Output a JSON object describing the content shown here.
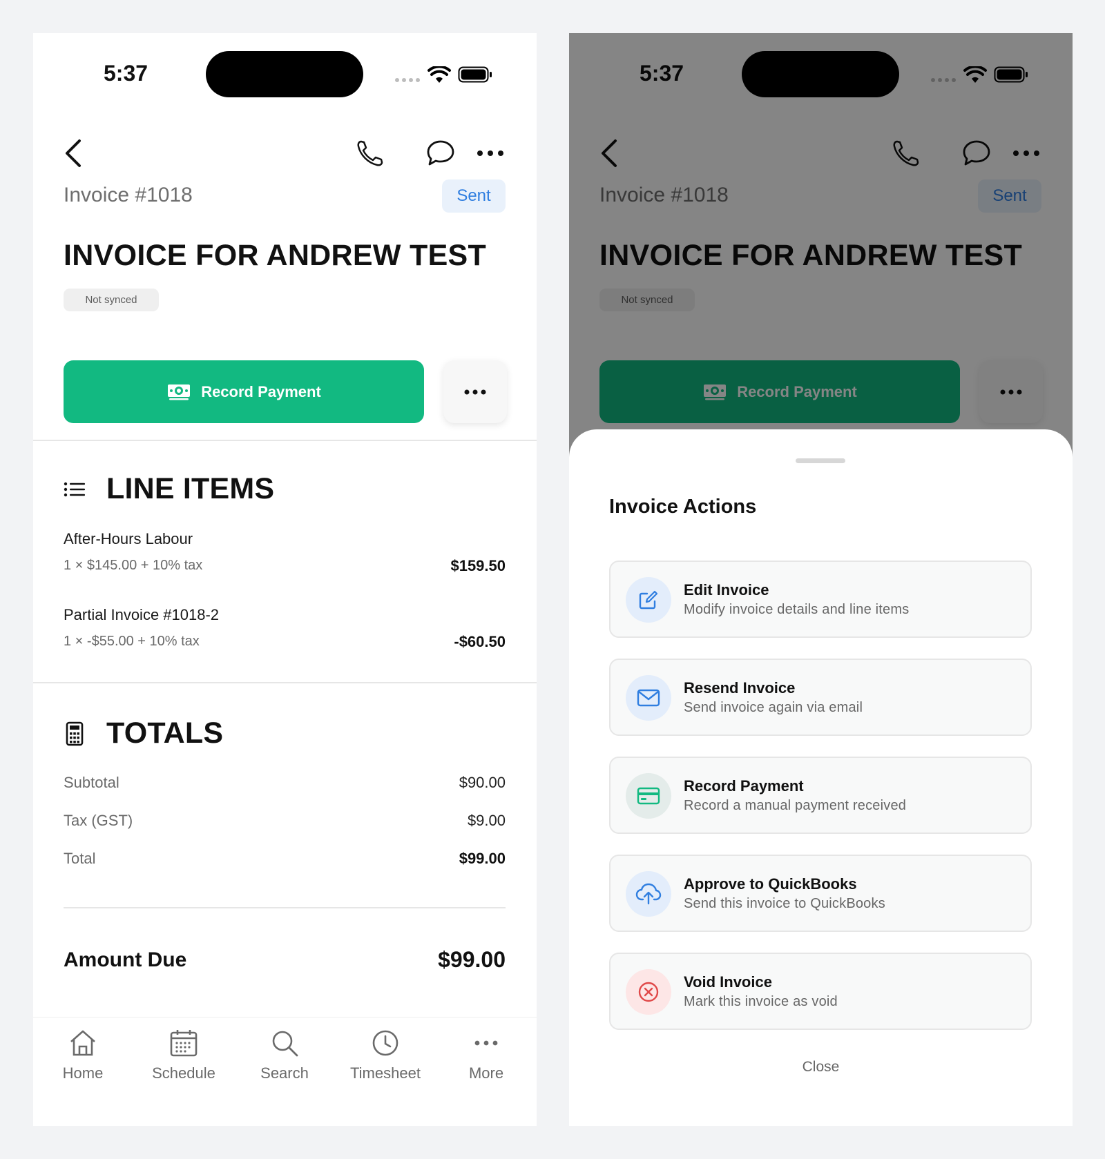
{
  "colors": {
    "green": "#12b981",
    "blue": "#2f7ee0",
    "red": "#e04848",
    "icon_blue_bg": "#e3edfb",
    "icon_green_bg": "#e4ecea",
    "icon_red_bg": "#fde6e6"
  },
  "status": {
    "time": "5:37"
  },
  "header": {
    "invoice_number": "Invoice #1018",
    "status_badge": "Sent",
    "title": "INVOICE FOR ANDREW TEST",
    "sync_badge": "Not synced"
  },
  "primary_action": {
    "label": "Record Payment",
    "icon": "cash-icon"
  },
  "line_items": {
    "heading": "LINE ITEMS",
    "items": [
      {
        "name": "After-Hours Labour",
        "detail": "1 × $145.00 + 10% tax",
        "amount": "$159.50"
      },
      {
        "name": "Partial Invoice #1018-2",
        "detail": "1 × -$55.00 + 10% tax",
        "amount": "-$60.50"
      }
    ]
  },
  "totals": {
    "heading": "TOTALS",
    "rows": [
      {
        "label": "Subtotal",
        "value": "$90.00"
      },
      {
        "label": "Tax (GST)",
        "value": "$9.00"
      },
      {
        "label": "Total",
        "value": "$99.00"
      }
    ],
    "amount_due_label": "Amount Due",
    "amount_due_value": "$99.00"
  },
  "tabbar": {
    "tabs": [
      {
        "label": "Home",
        "icon": "home-icon"
      },
      {
        "label": "Schedule",
        "icon": "calendar-icon"
      },
      {
        "label": "Search",
        "icon": "search-icon"
      },
      {
        "label": "Timesheet",
        "icon": "clock-icon"
      },
      {
        "label": "More",
        "icon": "more-icon"
      }
    ]
  },
  "sheet": {
    "title": "Invoice Actions",
    "actions": [
      {
        "title": "Edit Invoice",
        "subtitle": "Modify invoice details and line items",
        "icon": "edit-icon"
      },
      {
        "title": "Resend Invoice",
        "subtitle": "Send invoice again via email",
        "icon": "mail-icon"
      },
      {
        "title": "Record Payment",
        "subtitle": "Record a manual payment received",
        "icon": "card-icon"
      },
      {
        "title": "Approve to QuickBooks",
        "subtitle": "Send this invoice to QuickBooks",
        "icon": "cloud-upload-icon"
      },
      {
        "title": "Void Invoice",
        "subtitle": "Mark this invoice as void",
        "icon": "void-icon"
      }
    ],
    "close_label": "Close"
  }
}
